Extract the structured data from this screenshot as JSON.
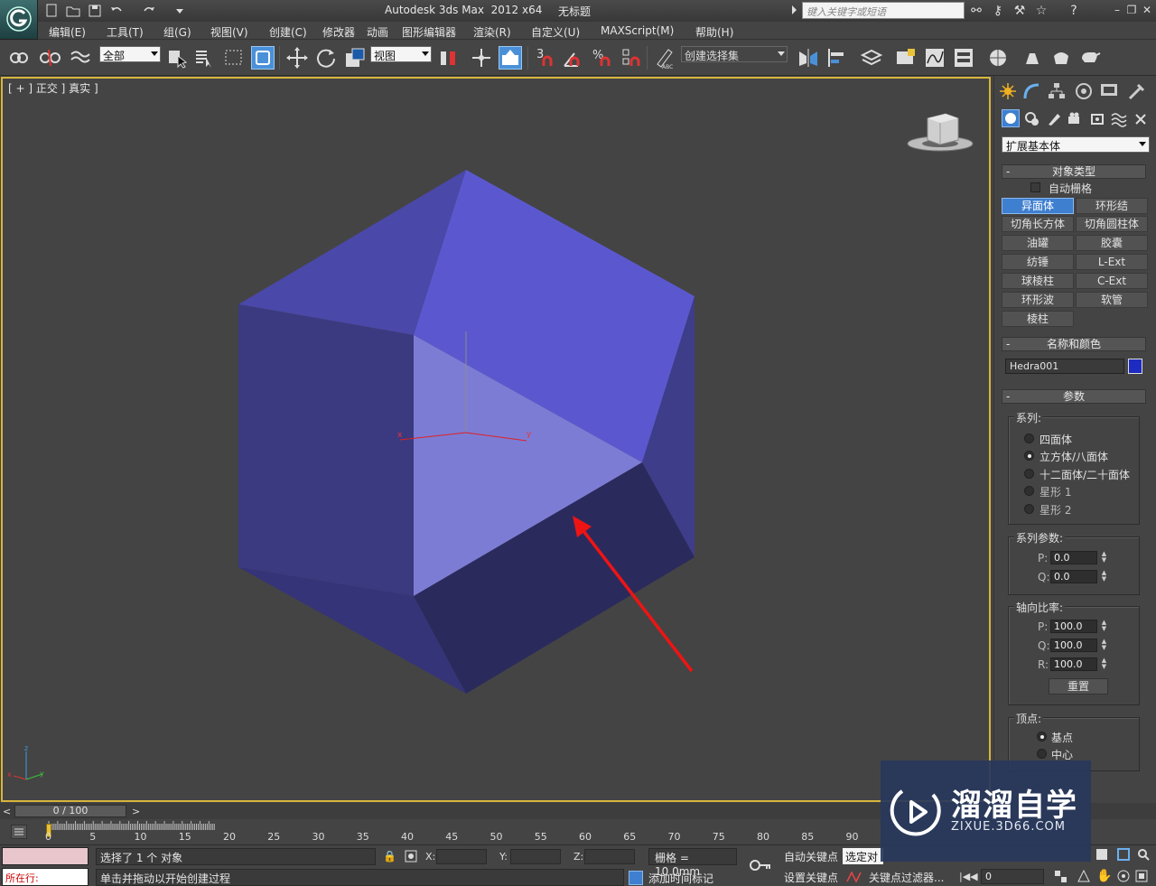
{
  "app": {
    "title": "Autodesk 3ds Max  2012 x64",
    "document": "无标题",
    "search_placeholder": "键入关键字或短语"
  },
  "menu": [
    "编辑(E)",
    "工具(T)",
    "组(G)",
    "视图(V)",
    "创建(C)",
    "修改器",
    "动画",
    "图形编辑器",
    "渲染(R)",
    "自定义(U)",
    "MAXScript(M)",
    "帮助(H)"
  ],
  "toolbar": {
    "filter": "全部",
    "coord_system": "视图",
    "snap_number": "3",
    "selection_set": "创建选择集"
  },
  "viewport": {
    "label": "[ + ] 正交 ] 真实 ]",
    "object_color": "#5b58cf",
    "axis_x": "x",
    "axis_y": "y",
    "axis_z": "z"
  },
  "command_panel": {
    "category": "扩展基本体",
    "object_type": {
      "title": "对象类型",
      "autogrid": "自动栅格",
      "buttons": [
        "异面体",
        "环形结",
        "切角长方体",
        "切角圆柱体",
        "油罐",
        "胶囊",
        "纺锤",
        "L-Ext",
        "球棱柱",
        "C-Ext",
        "环形波",
        "软管",
        "棱柱"
      ],
      "active": "异面体"
    },
    "name_color": {
      "title": "名称和颜色",
      "name": "Hedra001",
      "color": "#1e2bc0"
    },
    "params": {
      "title": "参数",
      "family_label": "系列:",
      "families": [
        "四面体",
        "立方体/八面体",
        "十二面体/二十面体",
        "星形 1",
        "星形 2"
      ],
      "selected_family": 1,
      "family_params_label": "系列参数:",
      "p": "0.0",
      "q": "0.0",
      "axis_label": "轴向比率:",
      "ap": "100.0",
      "aq": "100.0",
      "ar": "100.0",
      "reset": "重置",
      "vertex_label": "顶点:",
      "vertex_opt1": "基点",
      "vertex_opt2": "中心"
    }
  },
  "timeline": {
    "slider": "0 / 100",
    "ticks": [
      "0",
      "5",
      "10",
      "15",
      "20",
      "25",
      "30",
      "35",
      "40",
      "45",
      "50",
      "55",
      "60",
      "65",
      "70",
      "75",
      "80",
      "85",
      "90"
    ]
  },
  "status": {
    "selection": "选择了 1 个 对象",
    "prompt": "单击并拖动以开始创建过程",
    "x_label": "X:",
    "y_label": "Y:",
    "z_label": "Z:",
    "grid": "栅格 = 10.0mm",
    "add_time": "添加时间标记",
    "auto_key": "自动关键点",
    "set_key": "设置关键点",
    "selected": "选定对",
    "key_filter": "关键点过滤器...",
    "frame": "0",
    "running": "所在行:"
  },
  "watermark": {
    "title": "溜溜自学",
    "url": "ZIXUE.3D66.COM"
  }
}
